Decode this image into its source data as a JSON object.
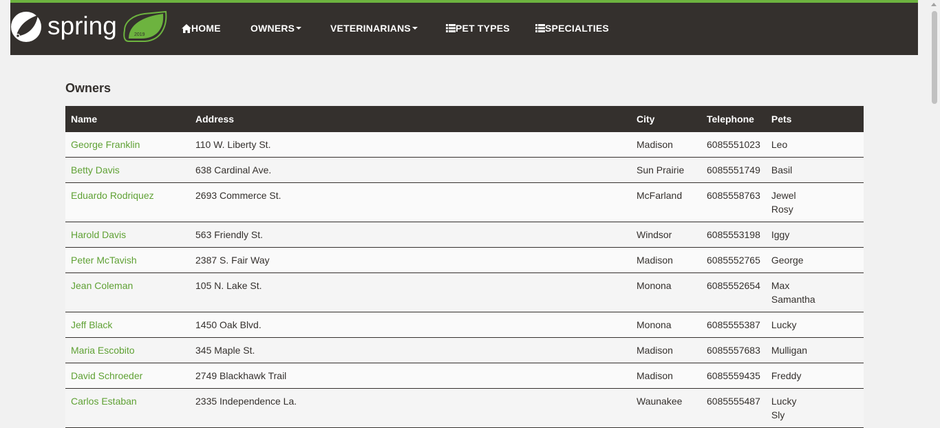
{
  "brand": {
    "logo_text": "spring",
    "logo_badge": "2019"
  },
  "nav": {
    "home": "HOME",
    "owners": "OWNERS",
    "veterinarians": "VETERINARIANS",
    "pet_types": "PET TYPES",
    "specialties": "SPECIALTIES"
  },
  "page": {
    "title": "Owners"
  },
  "table": {
    "headers": {
      "name": "Name",
      "address": "Address",
      "city": "City",
      "telephone": "Telephone",
      "pets": "Pets"
    },
    "rows": [
      {
        "name": "George Franklin",
        "address": "110 W. Liberty St.",
        "city": "Madison",
        "telephone": "6085551023",
        "pets": [
          "Leo"
        ]
      },
      {
        "name": "Betty Davis",
        "address": "638 Cardinal Ave.",
        "city": "Sun Prairie",
        "telephone": "6085551749",
        "pets": [
          "Basil"
        ]
      },
      {
        "name": "Eduardo Rodriquez",
        "address": "2693 Commerce St.",
        "city": "McFarland",
        "telephone": "6085558763",
        "pets": [
          "Jewel",
          "Rosy"
        ]
      },
      {
        "name": "Harold Davis",
        "address": "563 Friendly St.",
        "city": "Windsor",
        "telephone": "6085553198",
        "pets": [
          "Iggy"
        ]
      },
      {
        "name": "Peter McTavish",
        "address": "2387 S. Fair Way",
        "city": "Madison",
        "telephone": "6085552765",
        "pets": [
          "George"
        ]
      },
      {
        "name": "Jean Coleman",
        "address": "105 N. Lake St.",
        "city": "Monona",
        "telephone": "6085552654",
        "pets": [
          "Max",
          "Samantha"
        ]
      },
      {
        "name": "Jeff Black",
        "address": "1450 Oak Blvd.",
        "city": "Monona",
        "telephone": "6085555387",
        "pets": [
          "Lucky"
        ]
      },
      {
        "name": "Maria Escobito",
        "address": "345 Maple St.",
        "city": "Madison",
        "telephone": "6085557683",
        "pets": [
          "Mulligan"
        ]
      },
      {
        "name": "David Schroeder",
        "address": "2749 Blackhawk Trail",
        "city": "Madison",
        "telephone": "6085559435",
        "pets": [
          "Freddy"
        ]
      },
      {
        "name": "Carlos Estaban",
        "address": "2335 Independence La.",
        "city": "Waunakee",
        "telephone": "6085555487",
        "pets": [
          "Lucky",
          "Sly"
        ]
      }
    ]
  },
  "colors": {
    "brand_green": "#6db33f",
    "link_green": "#5fa134",
    "dark": "#34302d"
  }
}
